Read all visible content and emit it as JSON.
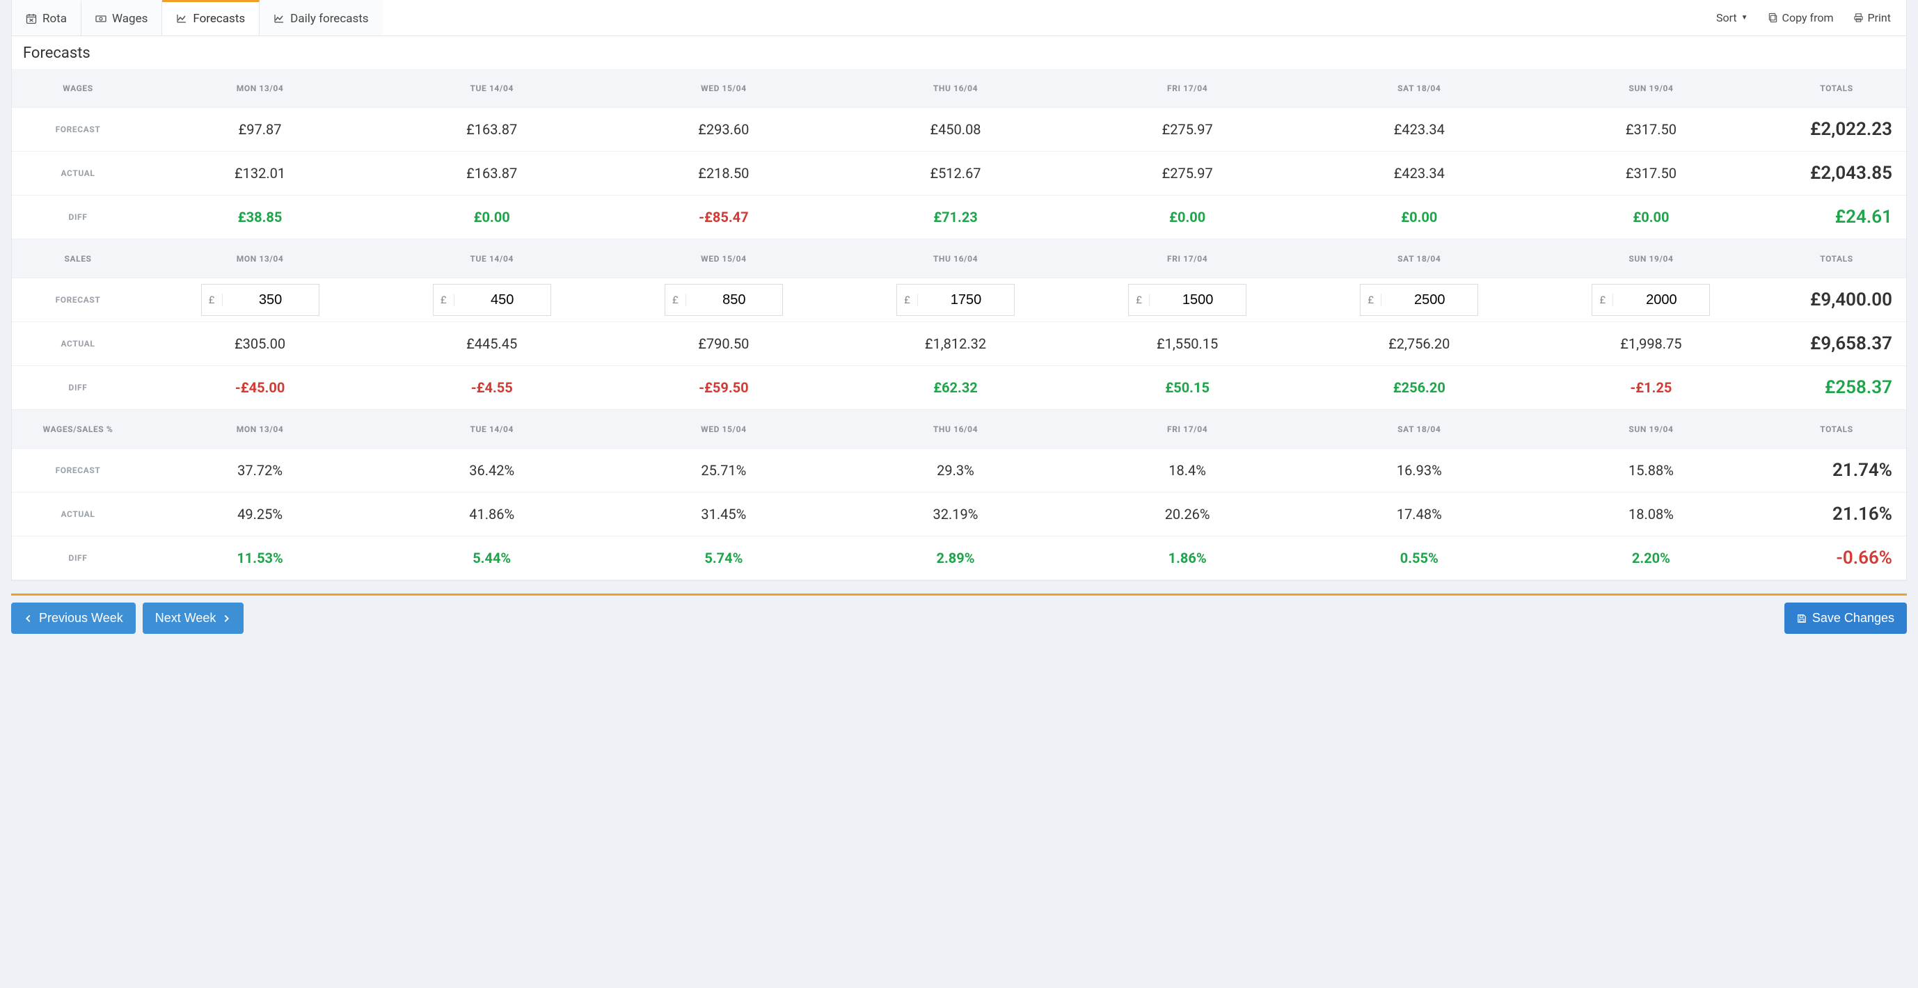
{
  "tabs": {
    "rota": "Rota",
    "wages": "Wages",
    "forecasts": "Forecasts",
    "daily": "Daily forecasts"
  },
  "tools": {
    "sort": "Sort",
    "copy": "Copy from",
    "print": "Print"
  },
  "page_title": "Forecasts",
  "days": [
    "MON 13/04",
    "TUE 14/04",
    "WED 15/04",
    "THU 16/04",
    "FRI 17/04",
    "SAT 18/04",
    "SUN 19/04"
  ],
  "totals_label": "TOTALS",
  "sections": {
    "wages": {
      "label": "WAGES",
      "rows": {
        "forecast": {
          "label": "FORECAST",
          "values": [
            "£97.87",
            "£163.87",
            "£293.60",
            "£450.08",
            "£275.97",
            "£423.34",
            "£317.50"
          ],
          "total": "£2,022.23"
        },
        "actual": {
          "label": "ACTUAL",
          "values": [
            "£132.01",
            "£163.87",
            "£218.50",
            "£512.67",
            "£275.97",
            "£423.34",
            "£317.50"
          ],
          "total": "£2,043.85"
        },
        "diff": {
          "label": "DIFF",
          "values": [
            "£38.85",
            "£0.00",
            "-£85.47",
            "£71.23",
            "£0.00",
            "£0.00",
            "£0.00"
          ],
          "total": "£24.61",
          "signs": [
            "pos",
            "pos",
            "neg",
            "pos",
            "pos",
            "pos",
            "pos"
          ],
          "total_sign": "pos"
        }
      }
    },
    "sales": {
      "label": "SALES",
      "rows": {
        "forecast": {
          "label": "FORECAST",
          "currency": "£",
          "inputs": [
            "350",
            "450",
            "850",
            "1750",
            "1500",
            "2500",
            "2000"
          ],
          "total": "£9,400.00"
        },
        "actual": {
          "label": "ACTUAL",
          "values": [
            "£305.00",
            "£445.45",
            "£790.50",
            "£1,812.32",
            "£1,550.15",
            "£2,756.20",
            "£1,998.75"
          ],
          "total": "£9,658.37"
        },
        "diff": {
          "label": "DIFF",
          "values": [
            "-£45.00",
            "-£4.55",
            "-£59.50",
            "£62.32",
            "£50.15",
            "£256.20",
            "-£1.25"
          ],
          "total": "£258.37",
          "signs": [
            "neg",
            "neg",
            "neg",
            "pos",
            "pos",
            "pos",
            "neg"
          ],
          "total_sign": "pos"
        }
      }
    },
    "ratio": {
      "label": "WAGES/SALES %",
      "rows": {
        "forecast": {
          "label": "FORECAST",
          "values": [
            "37.72%",
            "36.42%",
            "25.71%",
            "29.3%",
            "18.4%",
            "16.93%",
            "15.88%"
          ],
          "total": "21.74%"
        },
        "actual": {
          "label": "ACTUAL",
          "values": [
            "49.25%",
            "41.86%",
            "31.45%",
            "32.19%",
            "20.26%",
            "17.48%",
            "18.08%"
          ],
          "total": "21.16%"
        },
        "diff": {
          "label": "DIFF",
          "values": [
            "11.53%",
            "5.44%",
            "5.74%",
            "2.89%",
            "1.86%",
            "0.55%",
            "2.20%"
          ],
          "total": "-0.66%",
          "signs": [
            "pos",
            "pos",
            "pos",
            "pos",
            "pos",
            "pos",
            "pos"
          ],
          "total_sign": "neg"
        }
      }
    }
  },
  "footer": {
    "prev": "Previous Week",
    "next": "Next Week",
    "save": "Save Changes"
  }
}
